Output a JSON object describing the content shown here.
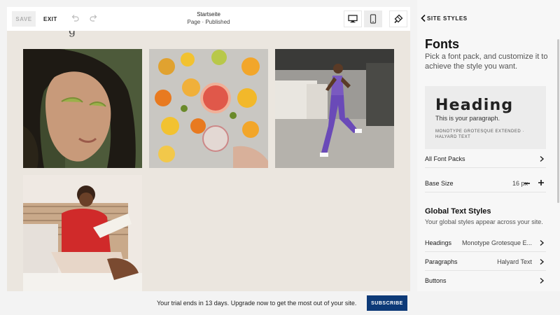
{
  "toolbar": {
    "save_label": "SAVE",
    "exit_label": "EXIT",
    "page_title": "Startseite",
    "page_status": "Page · Published"
  },
  "icons": {
    "undo": "undo-icon",
    "redo": "redo-icon",
    "desktop": "desktop-icon",
    "mobile": "mobile-icon",
    "brush": "paint-brush-icon",
    "back": "chevron-left-icon"
  },
  "panel": {
    "header": "SITE STYLES",
    "title": "Fonts",
    "subtitle": "Pick a font pack, and customize it to achieve the style you want.",
    "preview": {
      "heading": "Heading",
      "paragraph": "This is your paragraph.",
      "meta": "MONOTYPE GROTESQUE EXTENDED · HALYARD TEXT"
    },
    "all_font_packs": "All Font Packs",
    "base_size_label": "Base Size",
    "base_size_value": "16 px",
    "global_title": "Global Text Styles",
    "global_subtitle": "Your global styles appear across your site.",
    "rows": [
      {
        "label": "Headings",
        "value": "Monotype Grotesque E..."
      },
      {
        "label": "Paragraphs",
        "value": "Halyard Text"
      },
      {
        "label": "Buttons",
        "value": ""
      }
    ]
  },
  "trial": {
    "text": "Your trial ends in 13 days. Upgrade now to get the most out of your site.",
    "subscribe_label": "SUBSCRIBE"
  },
  "colors": {
    "subscribe_bg": "#0d3a78",
    "canvas_bg": "#ebe6df",
    "panel_bg": "#f7f7f7"
  }
}
